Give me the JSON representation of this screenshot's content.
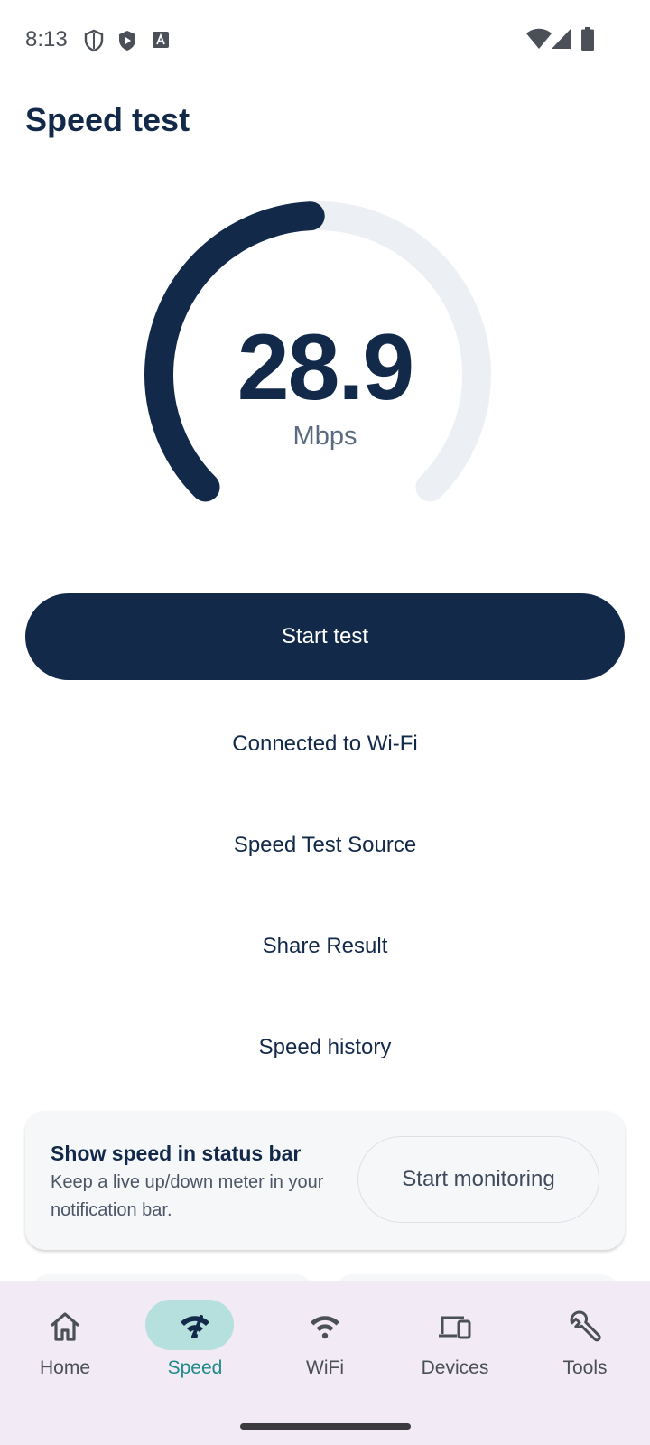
{
  "status_bar": {
    "time": "8:13",
    "left_icons": [
      "shield-outline-icon",
      "shield-play-icon",
      "font-a-icon"
    ],
    "right_icons": [
      "wifi-signal-icon",
      "cell-signal-icon",
      "battery-icon"
    ]
  },
  "page": {
    "title": "Speed test"
  },
  "gauge": {
    "value": "28.9",
    "unit": "Mbps",
    "fill_fraction": 0.49,
    "track_color": "#eceff4",
    "fill_color": "#12294a"
  },
  "actions": {
    "start_test": "Start test",
    "links": [
      "Connected to Wi-Fi",
      "Speed Test Source",
      "Share Result",
      "Speed history"
    ]
  },
  "monitor_card": {
    "title": "Show speed in status bar",
    "description": "Keep a live up/down meter in your notification bar.",
    "button": "Start monitoring"
  },
  "bottom_nav": {
    "items": [
      {
        "label": "Home",
        "icon": "home-icon",
        "active": false
      },
      {
        "label": "Speed",
        "icon": "speed-wifi-icon",
        "active": true
      },
      {
        "label": "WiFi",
        "icon": "wifi-icon",
        "active": false
      },
      {
        "label": "Devices",
        "icon": "devices-icon",
        "active": false
      },
      {
        "label": "Tools",
        "icon": "wrench-icon",
        "active": false
      }
    ]
  },
  "colors": {
    "primary": "#12294a",
    "nav_background": "#f2eaf5",
    "nav_active_pill": "#b5e0de",
    "nav_active_text": "#1f8a87"
  }
}
